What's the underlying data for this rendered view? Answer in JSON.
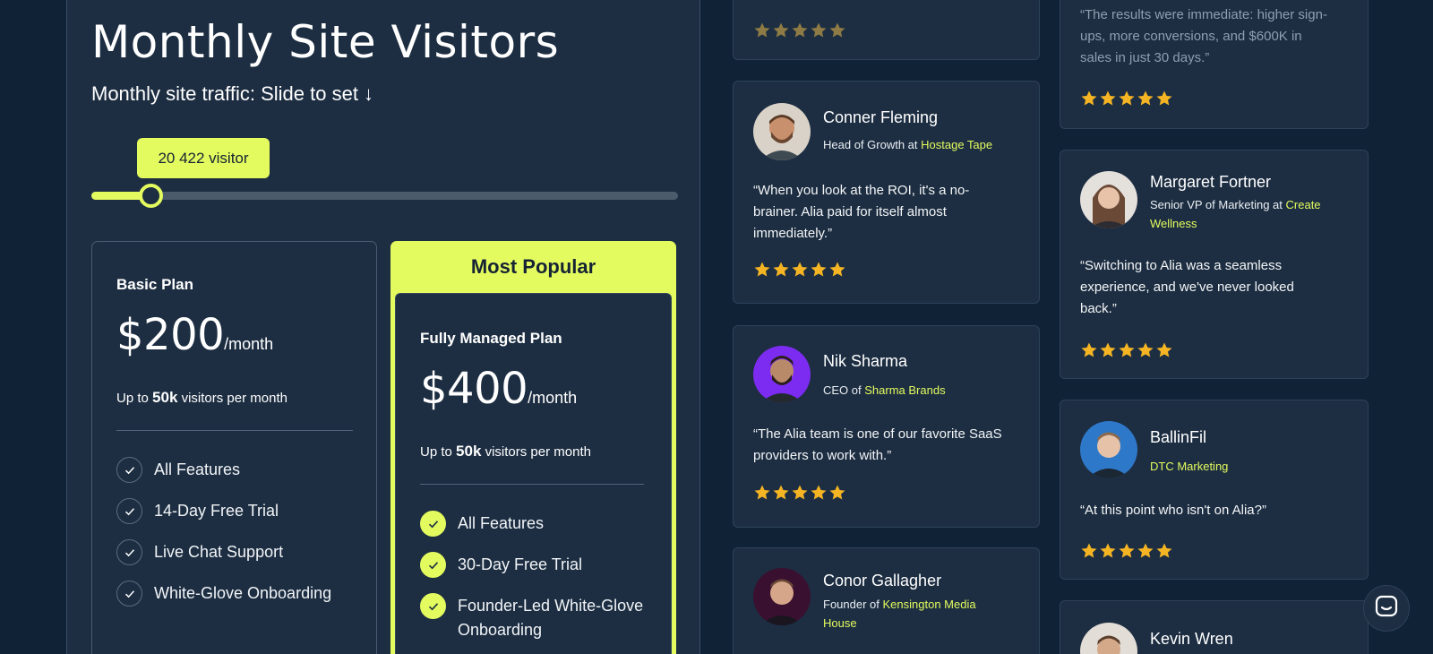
{
  "pricing": {
    "title": "Monthly Site Visitors",
    "subtitle": "Monthly site traffic: Slide to set ↓",
    "slider": {
      "tooltip": "20 422 visitor",
      "fraction": 0.1
    },
    "basic": {
      "name": "Basic Plan",
      "price": "$200",
      "period": "/month",
      "visitors_prefix": "Up to ",
      "visitors_bold": "50k",
      "visitors_suffix": " visitors per month",
      "features": [
        "All Features",
        "14-Day Free Trial",
        "Live Chat Support",
        "White-Glove Onboarding"
      ]
    },
    "popular": {
      "badge": "Most Popular",
      "name": "Fully Managed Plan",
      "price": "$400",
      "period": "/month",
      "visitors_prefix": "Up to ",
      "visitors_bold": "50k",
      "visitors_suffix": " visitors per month",
      "features": [
        "All Features",
        "30-Day Free Trial",
        "Founder-Led White-Glove",
        "Onboarding"
      ]
    }
  },
  "testimonials": {
    "col1": [
      {
        "rating": 5
      },
      {
        "name": "Conner Fleming",
        "role": "Head of Growth at ",
        "company": "Hostage Tape",
        "quote_lines": [
          "“When you look at the ROI, it's a no-",
          "brainer. Alia paid for itself almost",
          "immediately.”"
        ],
        "rating": 5
      },
      {
        "name": "Nik Sharma",
        "role": "CEO of ",
        "company": "Sharma Brands",
        "quote_lines": [
          "“The Alia team is one of our favorite SaaS",
          "providers to work with.”"
        ],
        "rating": 5
      },
      {
        "name": "Conor Gallagher",
        "role": "Founder of ",
        "company": "Kensington Media",
        "company2": "House"
      }
    ],
    "col2": [
      {
        "quote_lines": [
          "“The results were immediate: higher sign-",
          "ups, more conversions, and $600K in",
          "sales in just 30 days.”"
        ],
        "rating": 5
      },
      {
        "name": "Margaret Fortner",
        "role": "Senior VP of Marketing at ",
        "company": "Create",
        "company2": "Wellness",
        "quote_lines": [
          "“Switching to Alia was a seamless",
          "experience, and we've never looked",
          "back.”"
        ],
        "rating": 5
      },
      {
        "name": "BallinFil",
        "role": "",
        "company": "DTC Marketing",
        "quote_lines": [
          "“At this point who isn't on Alia?”"
        ],
        "rating": 5
      },
      {
        "name": "Kevin Wren"
      }
    ]
  },
  "colors": {
    "accent": "#e3fb5e",
    "panel": "#1d2e42",
    "background": "#0f2236",
    "star": "#f4b423"
  },
  "icons": {
    "check": "check-icon",
    "star": "star-icon",
    "chat": "chat-icon"
  }
}
